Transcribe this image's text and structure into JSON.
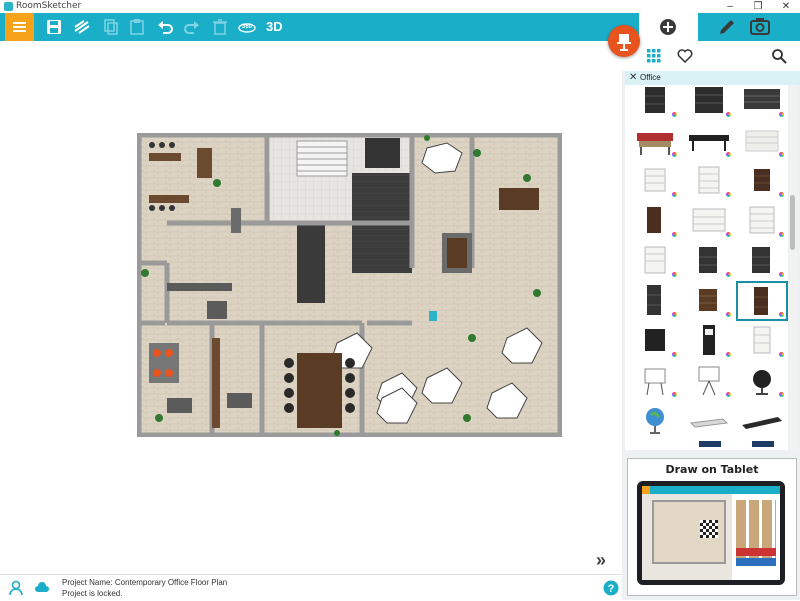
{
  "app": {
    "title": "RoomSketcher"
  },
  "window_controls": {
    "minimize": "–",
    "restore": "❐",
    "close": "✕"
  },
  "toolbar": {
    "items": [
      {
        "name": "menu-icon"
      },
      {
        "name": "save-icon"
      },
      {
        "name": "wall-tool-icon"
      },
      {
        "name": "copy-icon",
        "disabled": true
      },
      {
        "name": "paste-icon",
        "disabled": true
      },
      {
        "name": "undo-icon"
      },
      {
        "name": "redo-icon",
        "disabled": true
      },
      {
        "name": "delete-icon",
        "disabled": true
      },
      {
        "name": "view-360-icon"
      },
      {
        "name": "view-3d-label",
        "label": "3D"
      }
    ],
    "label_3d": "3D",
    "label_360": "360"
  },
  "right_tabs": [
    {
      "name": "add-icon",
      "active": true
    },
    {
      "name": "pencil-icon",
      "active": false
    },
    {
      "name": "camera-icon",
      "active": false
    }
  ],
  "catalog": {
    "category": "Office",
    "close_glyph": "✕",
    "toolbar_icons": [
      "grid-icon",
      "heart-icon",
      "search-icon"
    ]
  },
  "status": {
    "project_name": "Project Name: Contemporary Office Floor Plan",
    "locked": "Project is locked.",
    "help": "?"
  },
  "promo": {
    "title": "Draw on Tablet"
  },
  "nav": {
    "next": "»"
  },
  "colors": {
    "accent": "#1aaec9",
    "menu": "#f7a21b",
    "fab": "#e8531e",
    "selection": "#1a8fa6"
  }
}
